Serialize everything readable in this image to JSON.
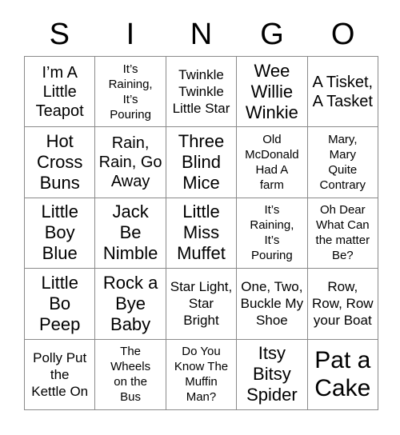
{
  "card": {
    "type": "bingo-card",
    "header": {
      "letters": [
        "S",
        "I",
        "N",
        "G",
        "O"
      ]
    },
    "grid": {
      "rows": 5,
      "columns": 5,
      "border_color": "#8a8a8a",
      "text_color": "#000000",
      "background_color": "#ffffff",
      "cells": [
        [
          {
            "text": "I’m A\nLittle\nTeapot",
            "size": "lg"
          },
          {
            "text": "It’s\nRaining,\nIt’s\nPouring",
            "size": "sm"
          },
          {
            "text": "Twinkle\nTwinkle\nLittle Star",
            "size": "md"
          },
          {
            "text": "Wee\nWillie\nWinkie",
            "size": "xl"
          },
          {
            "text": "A Tisket,\nA Tasket",
            "size": "lg"
          }
        ],
        [
          {
            "text": "Hot\nCross\nBuns",
            "size": "xl"
          },
          {
            "text": "Rain,\nRain, Go\nAway",
            "size": "lg"
          },
          {
            "text": "Three\nBlind\nMice",
            "size": "xl"
          },
          {
            "text": "Old\nMcDonald\nHad A\nfarm",
            "size": "sm"
          },
          {
            "text": "Mary,\nMary\nQuite\nContrary",
            "size": "sm"
          }
        ],
        [
          {
            "text": "Little\nBoy\nBlue",
            "size": "xl"
          },
          {
            "text": "Jack\nBe\nNimble",
            "size": "xl"
          },
          {
            "text": "Little\nMiss\nMuffet",
            "size": "xl"
          },
          {
            "text": "It’s\nRaining,\nIt’s\nPouring",
            "size": "sm"
          },
          {
            "text": "Oh Dear\nWhat Can\nthe matter\nBe?",
            "size": "sm"
          }
        ],
        [
          {
            "text": "Little\nBo\nPeep",
            "size": "xl"
          },
          {
            "text": "Rock a\nBye\nBaby",
            "size": "xl"
          },
          {
            "text": "Star Light,\nStar\nBright",
            "size": "md"
          },
          {
            "text": "One, Two,\nBuckle My\nShoe",
            "size": "md"
          },
          {
            "text": "Row,\nRow, Row\nyour Boat",
            "size": "md"
          }
        ],
        [
          {
            "text": "Polly Put\nthe\nKettle On",
            "size": "md"
          },
          {
            "text": "The\nWheels\non the\nBus",
            "size": "sm"
          },
          {
            "text": "Do You\nKnow The\nMuffin\nMan?",
            "size": "sm"
          },
          {
            "text": "Itsy\nBitsy\nSpider",
            "size": "xl"
          },
          {
            "text": "Pat a\nCake",
            "size": "xxl"
          }
        ]
      ]
    }
  }
}
